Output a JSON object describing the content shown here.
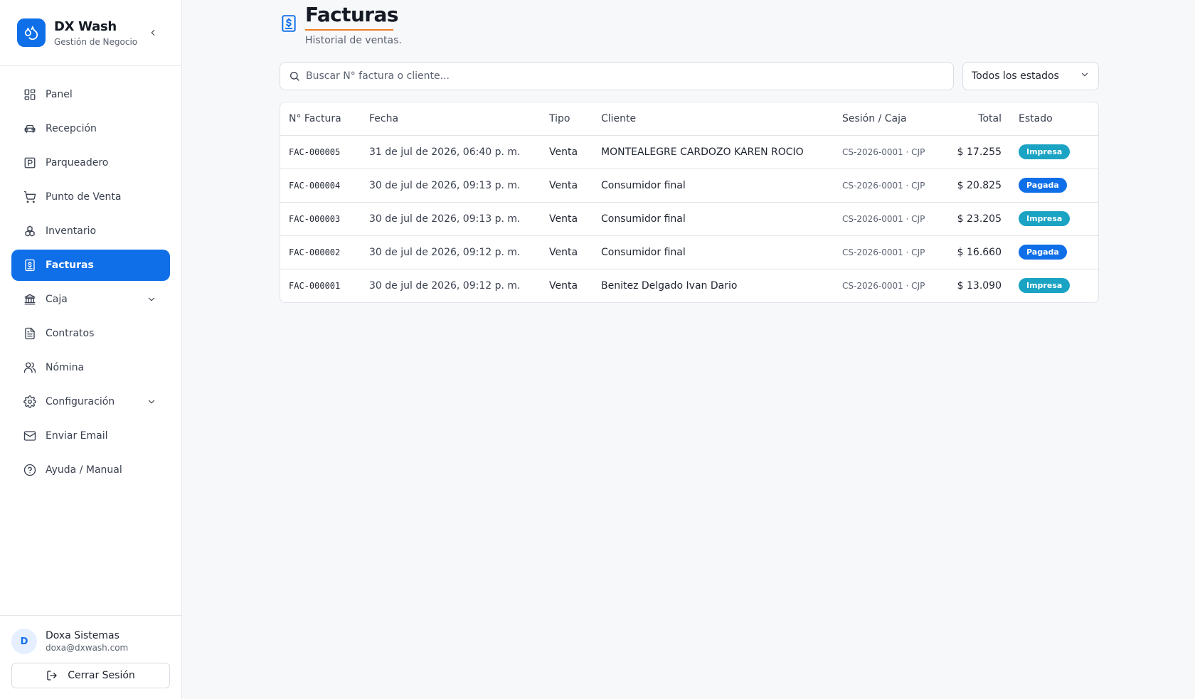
{
  "brand": {
    "name": "DX Wash",
    "subtitle": "Gestión de Negocio"
  },
  "nav": [
    {
      "label": "Panel",
      "icon": "dashboard-icon"
    },
    {
      "label": "Recepción",
      "icon": "car-icon"
    },
    {
      "label": "Parqueadero",
      "icon": "parking-icon"
    },
    {
      "label": "Punto de Venta",
      "icon": "cart-icon"
    },
    {
      "label": "Inventario",
      "icon": "boxes-icon"
    },
    {
      "label": "Facturas",
      "icon": "invoice-icon",
      "active": true
    },
    {
      "label": "Caja",
      "icon": "bank-icon",
      "expandable": true
    },
    {
      "label": "Contratos",
      "icon": "document-icon"
    },
    {
      "label": "Nómina",
      "icon": "users-icon"
    },
    {
      "label": "Configuración",
      "icon": "gear-icon",
      "expandable": true
    },
    {
      "label": "Enviar Email",
      "icon": "mail-icon"
    },
    {
      "label": "Ayuda / Manual",
      "icon": "help-icon"
    }
  ],
  "user": {
    "initial": "D",
    "name": "Doxa Sistemas",
    "email": "doxa@dxwash.com",
    "logout_label": "Cerrar Sesión"
  },
  "page": {
    "title": "Facturas",
    "subtitle": "Historial de ventas."
  },
  "filters": {
    "search_placeholder": "Buscar N° factura o cliente...",
    "status_selected": "Todos los estados"
  },
  "table": {
    "columns": [
      "N° Factura",
      "Fecha",
      "Tipo",
      "Cliente",
      "Sesión / Caja",
      "Total",
      "Estado"
    ],
    "rows": [
      {
        "numero": "FAC-000005",
        "fecha": "31 de jul de 2026, 06:40 p. m.",
        "tipo": "Venta",
        "cliente": "MONTEALEGRE CARDOZO KAREN ROCIO",
        "sesion": "CS-2026-0001 · CJP",
        "total": "$ 17.255",
        "estado": "Impresa"
      },
      {
        "numero": "FAC-000004",
        "fecha": "30 de jul de 2026, 09:13 p. m.",
        "tipo": "Venta",
        "cliente": "Consumidor final",
        "sesion": "CS-2026-0001 · CJP",
        "total": "$ 20.825",
        "estado": "Pagada"
      },
      {
        "numero": "FAC-000003",
        "fecha": "30 de jul de 2026, 09:13 p. m.",
        "tipo": "Venta",
        "cliente": "Consumidor final",
        "sesion": "CS-2026-0001 · CJP",
        "total": "$ 23.205",
        "estado": "Impresa"
      },
      {
        "numero": "FAC-000002",
        "fecha": "30 de jul de 2026, 09:12 p. m.",
        "tipo": "Venta",
        "cliente": "Consumidor final",
        "sesion": "CS-2026-0001 · CJP",
        "total": "$ 16.660",
        "estado": "Pagada"
      },
      {
        "numero": "FAC-000001",
        "fecha": "30 de jul de 2026, 09:12 p. m.",
        "tipo": "Venta",
        "cliente": "Benitez Delgado Ivan Dario",
        "sesion": "CS-2026-0001 · CJP",
        "total": "$ 13.090",
        "estado": "Impresa"
      }
    ]
  },
  "colors": {
    "accent": "#0f6fe8",
    "impresa": "#1aa3c3",
    "pagada": "#0f6fe8",
    "title_underline": "#f07b1f"
  }
}
